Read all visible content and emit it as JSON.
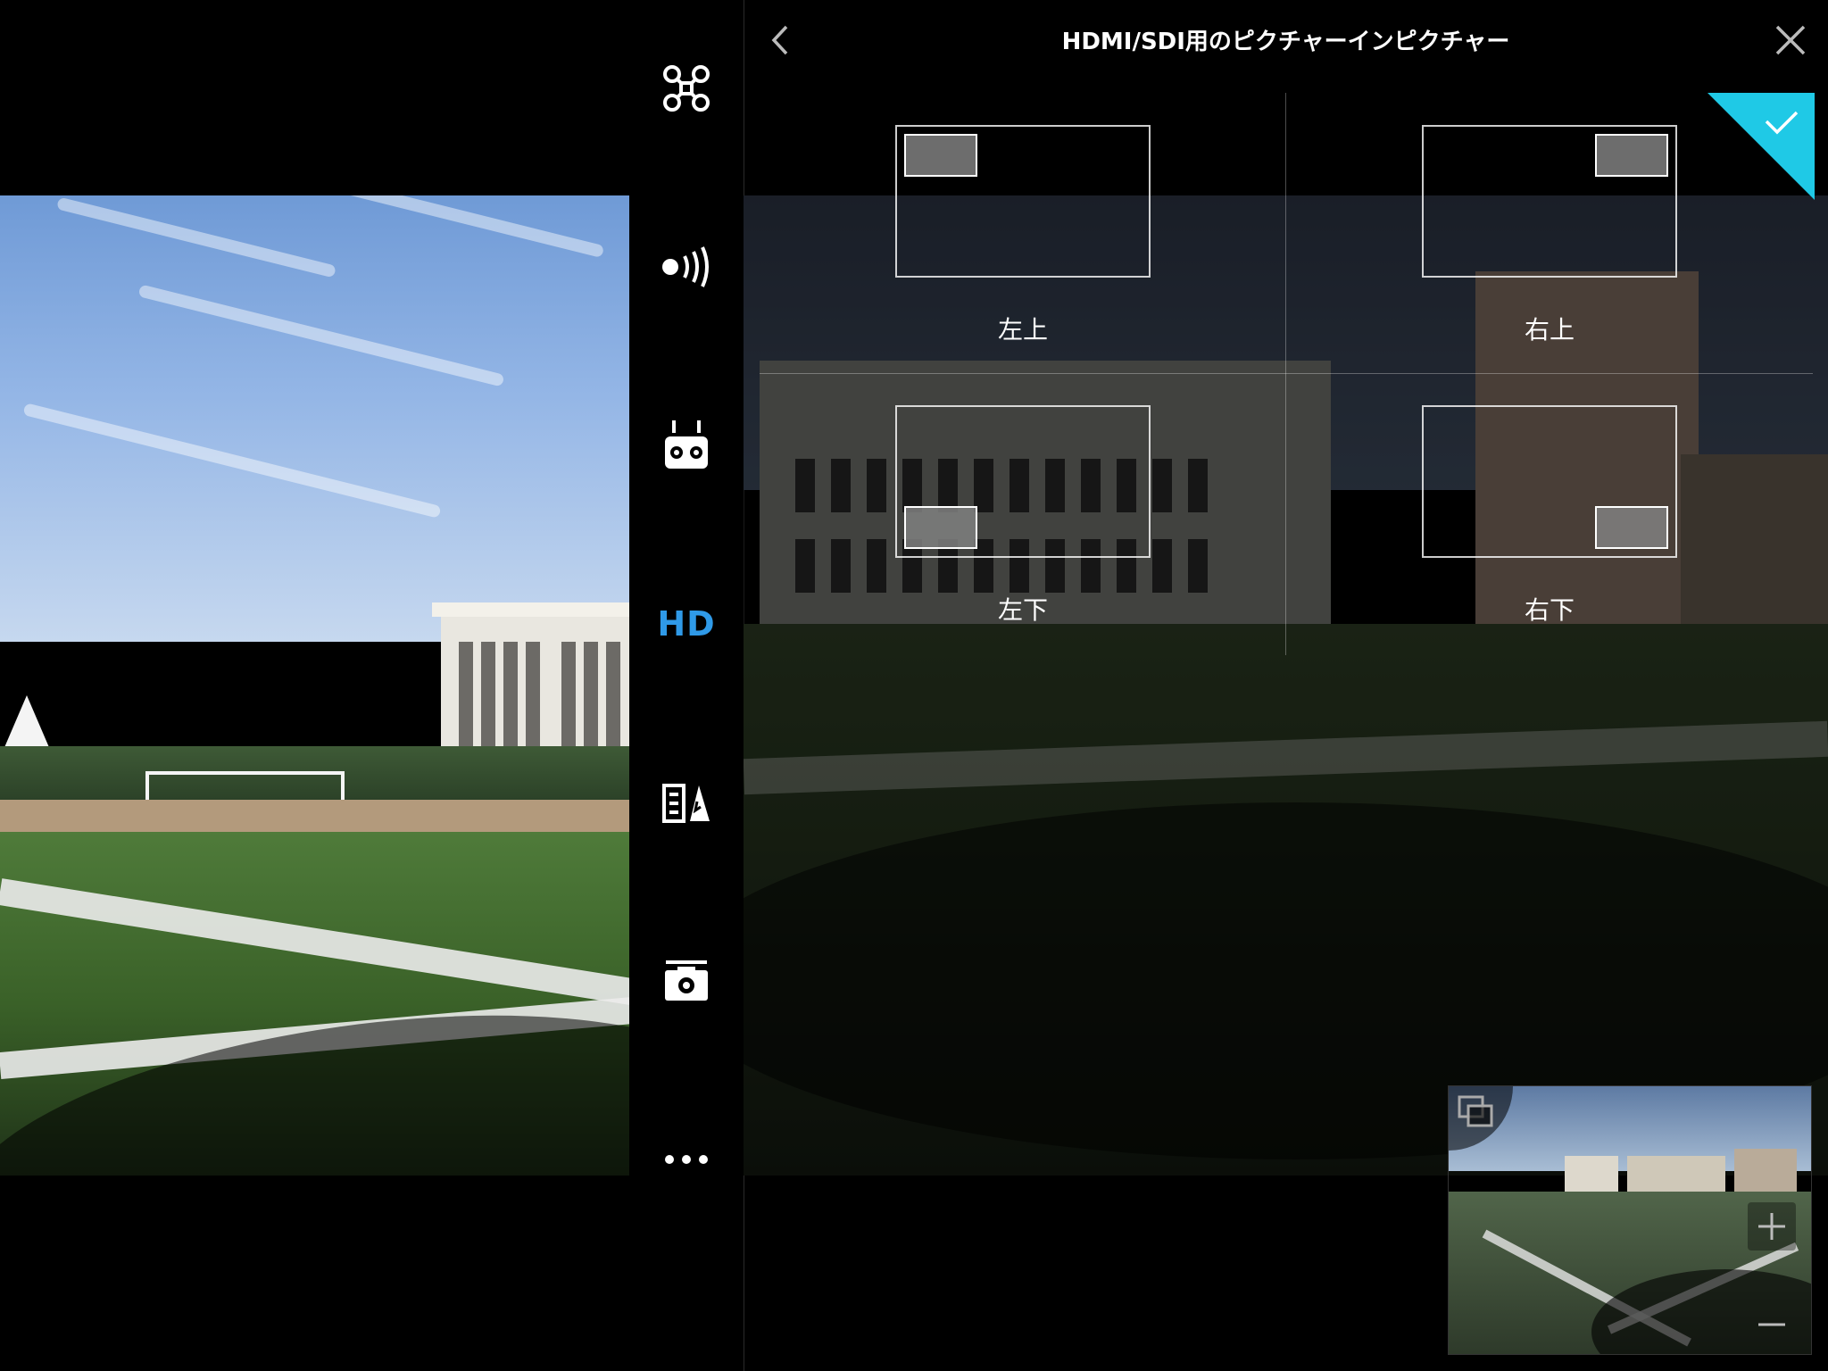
{
  "panel": {
    "title": "HDMI/SDI用のピクチャーインピクチャー",
    "options": [
      {
        "id": "top-left",
        "label": "左上",
        "pip_corner": "top-left",
        "selected": true
      },
      {
        "id": "top-right",
        "label": "右上",
        "pip_corner": "top-right",
        "selected": false
      },
      {
        "id": "bottom-left",
        "label": "左下",
        "pip_corner": "bottom-left",
        "selected": false
      },
      {
        "id": "bottom-right",
        "label": "右下",
        "pip_corner": "bottom-right",
        "selected": false
      }
    ],
    "selected_indicator_color": "#1fc9e6"
  },
  "toolbar": {
    "items": [
      {
        "name": "aircraft-icon"
      },
      {
        "name": "signal-icon"
      },
      {
        "name": "remote-controller-icon"
      },
      {
        "name": "hd-icon",
        "label": "HD",
        "active": true,
        "color": "#2f9ae8"
      },
      {
        "name": "battery-icon"
      },
      {
        "name": "camera-icon"
      },
      {
        "name": "more-icon"
      }
    ]
  },
  "minimap": {
    "icons": [
      "switch-view-icon",
      "plus-icon",
      "minus-icon"
    ]
  }
}
